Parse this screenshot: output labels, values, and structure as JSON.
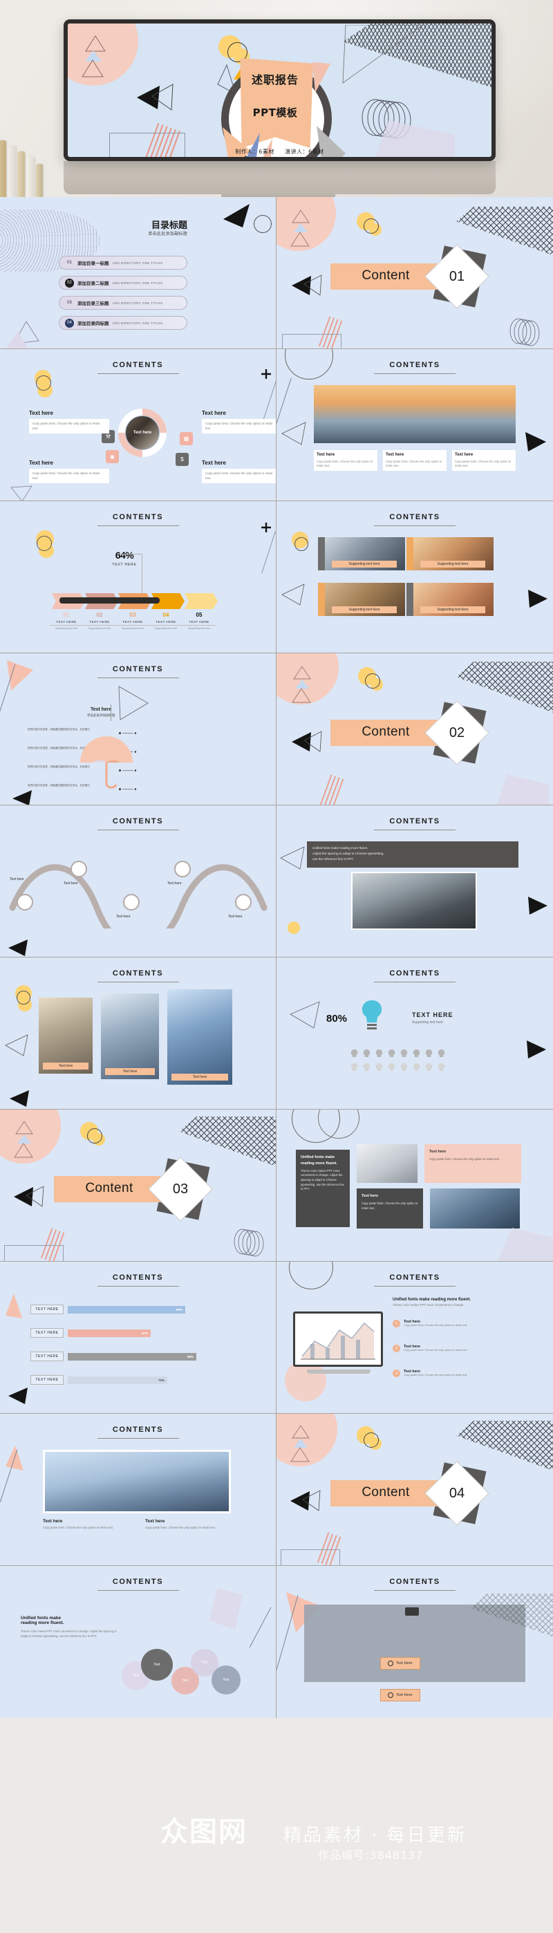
{
  "hero": {
    "title_line1": "述职报告",
    "title_line2": "PPT模板",
    "credits_author_label": "制作人：",
    "credits_author": "6素材",
    "credits_speaker_label": "演讲人：",
    "credits_speaker": "6素材"
  },
  "colors": {
    "slide_bg": "#dbe6f6",
    "accent_peach": "#f6bf97",
    "accent_pink": "#f6cdc1",
    "accent_yellow": "#fbd372",
    "accent_dark": "#4a4a4a",
    "accent_lilac": "#ddd8ea",
    "ink": "#1d1d1d"
  },
  "section_heading": "CONTENTS",
  "toc": {
    "title": "目录标题",
    "subtitle": "单击此处添加副标题",
    "items": [
      {
        "num": "01",
        "cn": "添加目录一标题",
        "en": "ADD DIRECTORY ONE TITLES",
        "style": "light"
      },
      {
        "num": "02",
        "cn": "添加目录二标题",
        "en": "ADD DIRECTORY ONE TITLES",
        "style": "dark"
      },
      {
        "num": "03",
        "cn": "添加目录三标题",
        "en": "ADD DIRECTORY ONE TITLES",
        "style": "light"
      },
      {
        "num": "04",
        "cn": "添加目录四标题",
        "en": "ADD DIRECTORY ONE TITLES",
        "style": "navy"
      }
    ]
  },
  "dividers": [
    {
      "label": "Content",
      "number": "01"
    },
    {
      "label": "Content",
      "number": "02"
    },
    {
      "label": "Content",
      "number": "03"
    },
    {
      "label": "Content",
      "number": "04"
    }
  ],
  "circle_slide": {
    "heading": "CONTENTS",
    "center_label": "Text here",
    "boxes": [
      {
        "title": "Text here",
        "body": "Copy paste fonts. Choose the only option to retain text."
      },
      {
        "title": "Text here",
        "body": "Copy paste fonts. Choose the only option to retain text."
      },
      {
        "title": "Text here",
        "body": "Copy paste fonts. Choose the only option to retain text."
      },
      {
        "title": "Text here",
        "body": "Copy paste fonts. Choose the only option to retain text."
      }
    ],
    "icons": [
      "tools-icon",
      "bar-chart-icon",
      "target-icon",
      "dollar-icon"
    ]
  },
  "city_slide": {
    "heading": "CONTENTS",
    "captions": [
      {
        "title": "Text here",
        "body": "Copy paste fonts. Choose the only option to retain text."
      },
      {
        "title": "Text here",
        "body": "Copy paste fonts. Choose the only option to retain text."
      },
      {
        "title": "Text here",
        "body": "Copy paste fonts. Choose the only option to retain text."
      }
    ]
  },
  "arrow_slide": {
    "heading": "CONTENTS",
    "kpi_value": "64%",
    "kpi_label": "TEXT HERE",
    "steps": [
      {
        "num": "01",
        "title": "TEXT HERE",
        "sub": "Supporting text here"
      },
      {
        "num": "02",
        "title": "TEXT HERE",
        "sub": "Supporting text here"
      },
      {
        "num": "03",
        "title": "TEXT HERE",
        "sub": "Supporting text here"
      },
      {
        "num": "04",
        "title": "TEXT HERE",
        "sub": "Supporting text here"
      },
      {
        "num": "05",
        "title": "TEXT HERE",
        "sub": "Supporting text here"
      }
    ]
  },
  "photo_grid_slide": {
    "heading": "CONTENTS",
    "cards": [
      {
        "caption": "Supporting text here"
      },
      {
        "caption": "Supporting text here"
      },
      {
        "caption": "Supporting text here"
      },
      {
        "caption": "Supporting text here"
      }
    ]
  },
  "umbrella_slide": {
    "heading": "CONTENTS",
    "right_title": "Text here",
    "right_sub": "单击此处添加副标题",
    "rows": [
      {
        "text": "您的内容打在这里，或者通过复制您的文本后，在此框中"
      },
      {
        "text": "您的内容打在这里，或者通过复制您的文本后，在此框中"
      },
      {
        "text": "您的内容打在这里，或者通过复制您的文本后，在此框中"
      },
      {
        "text": "您的内容打在这里，或者通过复制您的文本后，在此框中"
      }
    ]
  },
  "meeting_slide": {
    "heading": "CONTENTS",
    "band_line1": "Unified fonts make reading more fluent.",
    "band_line2": "Adjust the spacing to adapt to Chinese typesetting,",
    "band_line3": "use the reference line in PPT."
  },
  "snake_slide": {
    "heading": "CONTENTS",
    "nodes": [
      "Text here",
      "Text here",
      "Text here",
      "Text here",
      "Text here"
    ]
  },
  "bulb_slide": {
    "heading": "CONTENTS",
    "value": "80%",
    "title": "TEXT HERE",
    "sub": "Supporting text here"
  },
  "tower_slide": {
    "heading": "CONTENTS",
    "captions": [
      "Text here",
      "Text here",
      "Text here"
    ]
  },
  "dark_cards_slide": {
    "heading": "CONTENTS",
    "left_card": {
      "title": "Unified fonts make reading more fluent.",
      "body": "Theme color makes PPT more convenient to change. Adjust the spacing to adapt to Chinese typesetting, use the reference line in PPT."
    },
    "right_card": {
      "title": "Text here",
      "body": "Copy paste fonts. Choose the only option to retain text."
    },
    "bottom_card": {
      "title": "Text here",
      "body": "Copy paste fonts. Choose the only option to retain text."
    }
  },
  "bars_slide": {
    "heading": "CONTENTS",
    "rows": [
      {
        "label": "TEXT HERE",
        "value": "89%",
        "pct": 89,
        "color": "#9fc0e4"
      },
      {
        "label": "TEXT HERE",
        "value": "57%",
        "pct": 57,
        "color": "#f0b0a4"
      },
      {
        "label": "TEXT HERE",
        "value": "98%",
        "pct": 98,
        "color": "#9b9b9b"
      },
      {
        "label": "TEXT HERE",
        "value": "72%",
        "pct": 72,
        "color": "#cfd8e6"
      }
    ]
  },
  "chart_slide": {
    "heading": "CONTENTS",
    "lede": "Unified fonts make reading more fluent.",
    "sub": "Theme color makes PPT more convenient to change.",
    "items": [
      {
        "num": "1",
        "title": "Text here",
        "body": "Copy paste fonts. Choose the only option to retain text."
      },
      {
        "num": "2",
        "title": "Text here",
        "body": "Copy paste fonts. Choose the only option to retain text."
      },
      {
        "num": "3",
        "title": "Text here",
        "body": "Copy paste fonts. Choose the only option to retain text."
      }
    ]
  },
  "skyline_slide": {
    "heading": "CONTENTS",
    "cards": [
      {
        "title": "Text here",
        "body": "Copy paste fonts. Choose the only option to retain text."
      },
      {
        "title": "Text here",
        "body": "Copy paste fonts. Choose the only option to retain text."
      }
    ]
  },
  "bubbles_slide": {
    "heading": "CONTENTS",
    "lede_line1": "Unified fonts make",
    "lede_line2": "reading more fluent.",
    "body": "Theme color makes PPT more convenient to change. Adjust the spacing to adapt to Chinese typesetting, use the reference line in PPT.",
    "bubbles": [
      "Text",
      "Text",
      "Text",
      "Text",
      "Text"
    ]
  },
  "thanks_slide": {
    "heading": "CONTENTS",
    "button_1": "Text Here",
    "button_2": "Text Here"
  },
  "watermark": {
    "logo": "众图网",
    "tagline": "精品素材 · 每日更新",
    "id": "作品编号:3848137"
  }
}
